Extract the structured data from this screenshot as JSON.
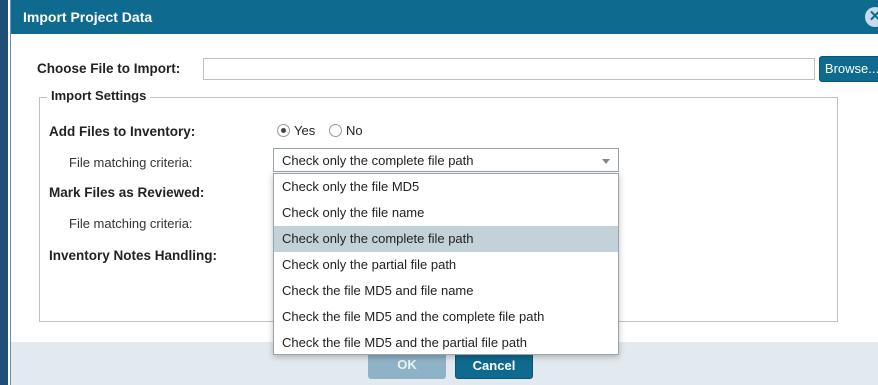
{
  "dialog": {
    "title": "Import Project Data",
    "close_icon": "close-circle-icon"
  },
  "file": {
    "label": "Choose File to Import:",
    "value": "",
    "browse_label": "Browse..."
  },
  "settings": {
    "legend": "Import Settings",
    "add_files": {
      "label": "Add Files to Inventory:",
      "yes_label": "Yes",
      "no_label": "No",
      "selected": "Yes",
      "criteria_label": "File matching criteria:",
      "criteria_value": "Check only the complete file path"
    },
    "mark_reviewed": {
      "label": "Mark Files as Reviewed:",
      "criteria_label": "File matching criteria:"
    },
    "notes": {
      "label": "Inventory Notes Handling:"
    }
  },
  "dropdown": {
    "options": [
      "Check only the file MD5",
      "Check only the file name",
      "Check only the complete file path",
      "Check only the partial file path",
      "Check the file MD5 and file name",
      "Check the file MD5 and the complete file path",
      "Check the file MD5 and the partial file path"
    ],
    "selected_index": 2
  },
  "footer": {
    "ok_label": "OK",
    "cancel_label": "Cancel"
  },
  "colors": {
    "titlebar": "#0f6a8f",
    "selected_option": "#c3d1d9"
  }
}
